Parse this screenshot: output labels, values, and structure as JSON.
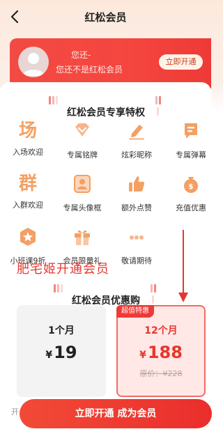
{
  "header": {
    "title": "红松会员"
  },
  "card": {
    "line1": "您还-",
    "line2": "您还不是红松会员",
    "button_label": "立即开通"
  },
  "perks_section": {
    "title": "红松会员专享特权",
    "items": [
      {
        "label": "入场欢迎",
        "icon": "enter-glyph-icon",
        "glyph": "场"
      },
      {
        "label": "专属铭牌",
        "icon": "diamond-badge-icon"
      },
      {
        "label": "炫彩昵称",
        "icon": "pencil-icon"
      },
      {
        "label": "专属弹幕",
        "icon": "message-icon"
      },
      {
        "label": "入群欢迎",
        "icon": "group-glyph-icon",
        "glyph": "群"
      },
      {
        "label": "专属头像框",
        "icon": "avatar-frame-icon"
      },
      {
        "label": "额外点赞",
        "icon": "thumbs-up-icon"
      },
      {
        "label": "充值优惠",
        "icon": "coin-bag-icon"
      },
      {
        "label": "小班课9折",
        "icon": "star-badge-icon"
      },
      {
        "label": "会员限量礼",
        "icon": "gift-icon"
      },
      {
        "label": "敬请期待",
        "icon": "more-dots-icon"
      }
    ]
  },
  "overlay_text": "肥宅姬开通会员",
  "plans_section": {
    "title": "红松会员优惠购"
  },
  "plans": [
    {
      "name": "1个月",
      "currency": "¥",
      "price": "19"
    },
    {
      "name": "12个月",
      "currency": "¥",
      "price": "188",
      "original": "原价：¥228",
      "badge": "超值特惠"
    }
  ],
  "cta": {
    "label": "立即开通 成为会员",
    "left_hint": "开"
  },
  "colors": {
    "brand_red": "#ee3a36",
    "perk_orange": "#f3a064"
  }
}
